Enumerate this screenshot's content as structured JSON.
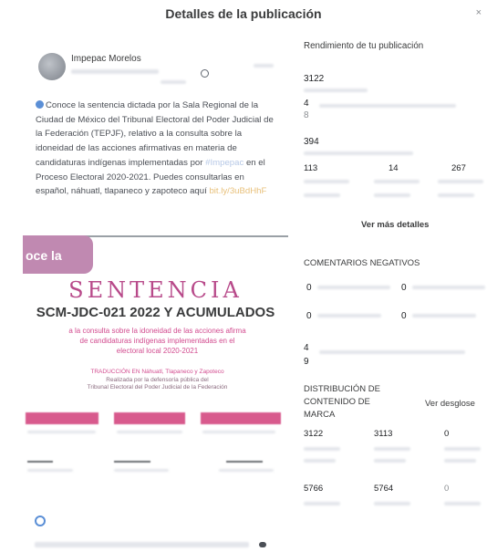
{
  "header": {
    "title": "Detalles de la publicación",
    "close": "×"
  },
  "post": {
    "author": "Impepac Morelos",
    "text_before_hashtag": "Conoce la sentencia dictada por la Sala Regional de la Ciudad de México del Tribunal Electoral del Poder Judicial de la Federación (TEPJF), relativo a la consulta sobre la idoneidad de las acciones afirmativas en materia de candidaturas indígenas implementadas por",
    "hashtag": "#Impepac",
    "text_after_hashtag": "en el Proceso Electoral 2020-2021. Puedes consultarlas en español, náhuatl, tlapaneco y zapoteco aquí",
    "link_text": "bit.ly/3uBdHhF",
    "image": {
      "pill_text": "oce la",
      "headline": "SENTENCIA",
      "case_number": "SCM-JDC-021 2022 Y ACUMULADOS",
      "line1": "a la consulta sobre la idoneidad de las acciones afirma",
      "line2": "de candidaturas indígenas implementadas en el",
      "line3": "electoral local 2020-2021",
      "translation_line1": "TRADUCCIÓN EN Náhuatl, Tlapaneco y Zapoteco",
      "translation_line2": "Realizada por la defensoría pública del",
      "translation_line3": "Tribunal Electoral del Poder Judicial de la Federación"
    }
  },
  "stats": {
    "performance_title": "Rendimiento de tu publicación",
    "reach": "3122",
    "interactions": "4",
    "interactions_sub": "8",
    "clicks": "394",
    "row_values": [
      "113",
      "14",
      "267"
    ],
    "more_details": "Ver más detalles",
    "negative_title": "COMENTARIOS NEGATIVOS",
    "negative_rows": [
      [
        "0",
        "0"
      ],
      [
        "0",
        "0"
      ]
    ],
    "negative_total_a": "4",
    "negative_total_b": "9",
    "branded_title_1": "DISTRIBUCIÓN DE",
    "branded_title_2": "CONTENIDO DE",
    "branded_title_3": "MARCA",
    "breakdown": "Ver desglose",
    "branded_row1": [
      "3122",
      "3113",
      "0"
    ],
    "branded_row2": [
      "5766",
      "5764",
      "0"
    ]
  },
  "colors": {
    "accent_pink": "#b84a8a",
    "pill": "#c089b1",
    "link_blue": "#5b8fd6"
  }
}
